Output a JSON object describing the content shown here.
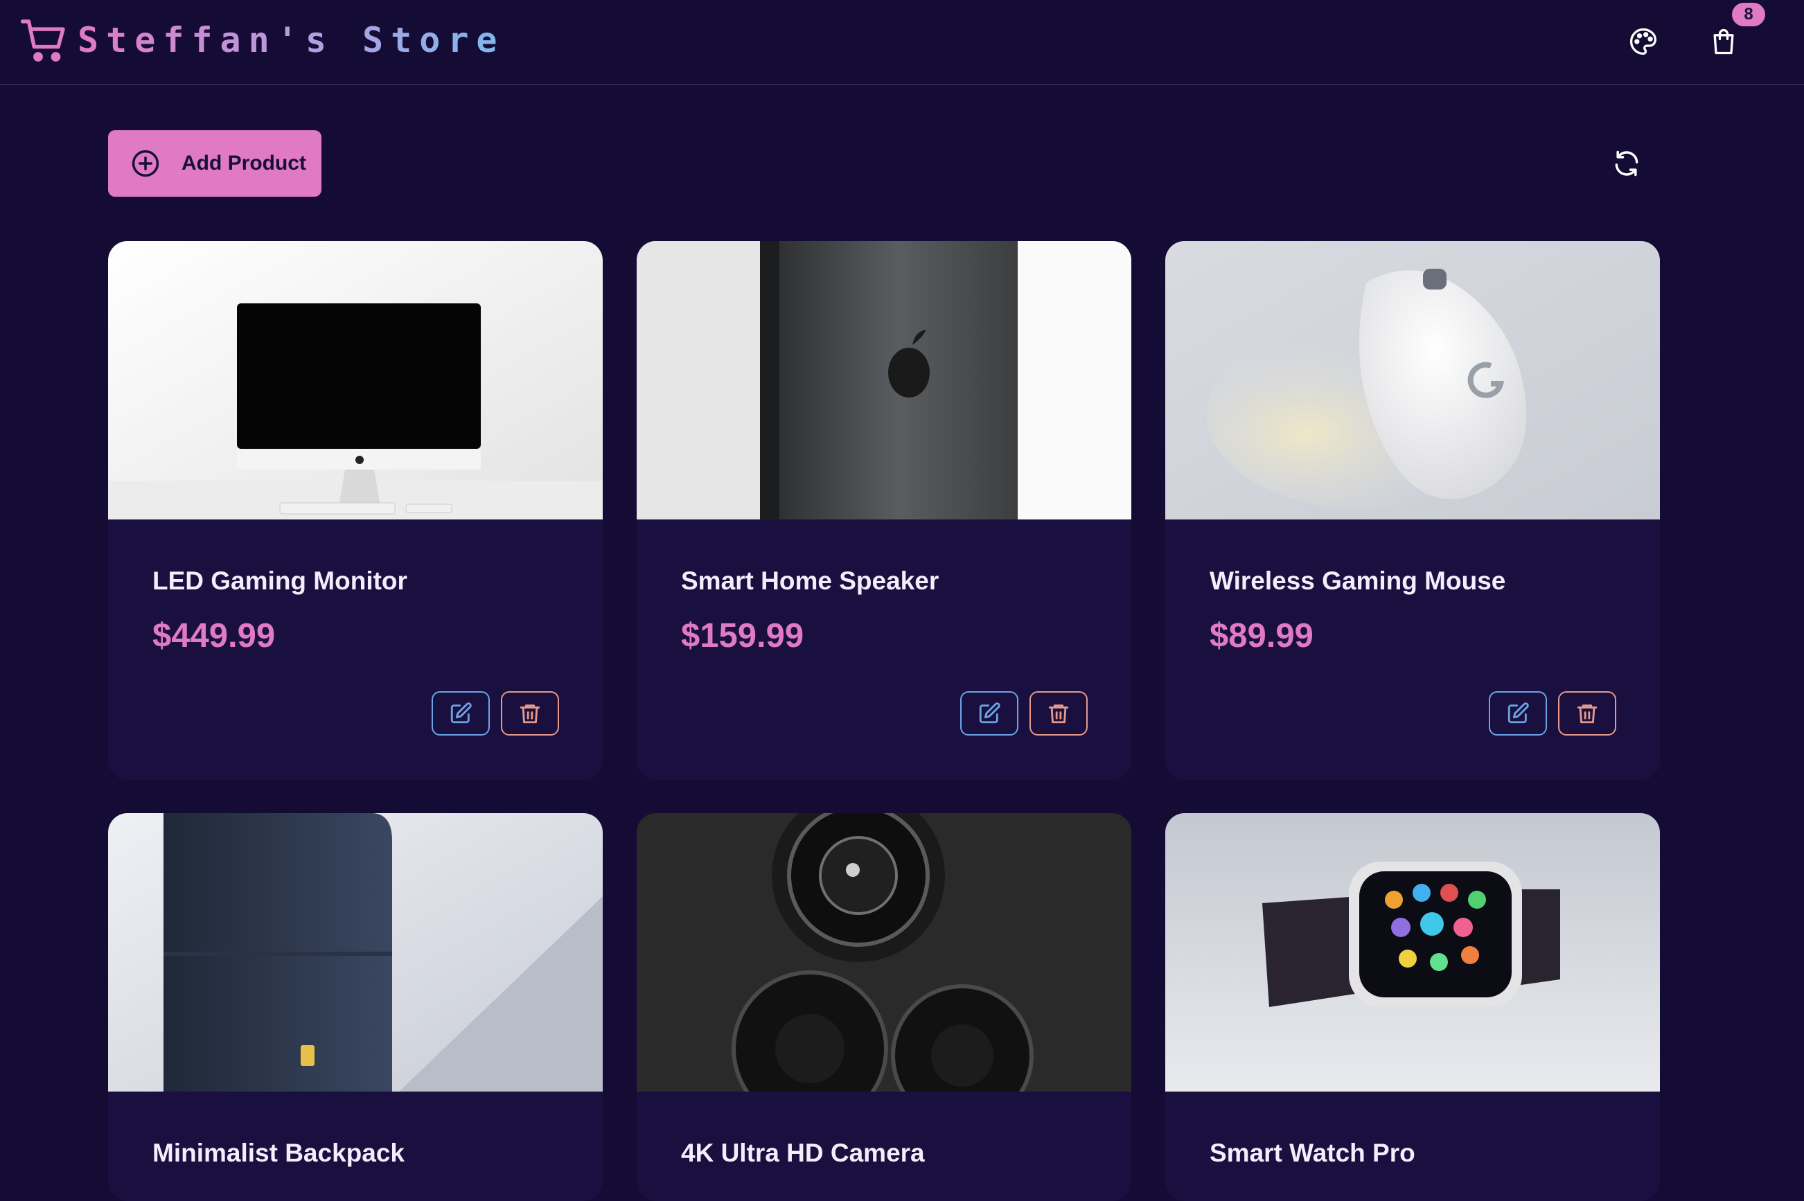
{
  "header": {
    "title": "Steffan's Store",
    "cart_count": "8",
    "icons": {
      "logo": "cart-icon",
      "theme": "palette-icon",
      "cart": "shopping-bag-icon"
    }
  },
  "toolbar": {
    "add_label": "Add Product",
    "add_icon": "plus-circle-icon",
    "refresh_icon": "refresh-icon"
  },
  "colors": {
    "background": "#140c34",
    "card": "#1a1040",
    "accent": "#e07ac4",
    "edit": "#6aa6e6",
    "delete": "#e79a8a"
  },
  "products": [
    {
      "name": "LED Gaming Monitor",
      "price": "$449.99",
      "image": "imac-monitor"
    },
    {
      "name": "Smart Home Speaker",
      "price": "$159.99",
      "image": "phone-back"
    },
    {
      "name": "Wireless Gaming Mouse",
      "price": "$89.99",
      "image": "white-mouse"
    },
    {
      "name": "Minimalist Backpack",
      "image": "navy-backpack"
    },
    {
      "name": "4K Ultra HD Camera",
      "image": "camera-lenses"
    },
    {
      "name": "Smart Watch Pro",
      "image": "smartwatch"
    }
  ]
}
